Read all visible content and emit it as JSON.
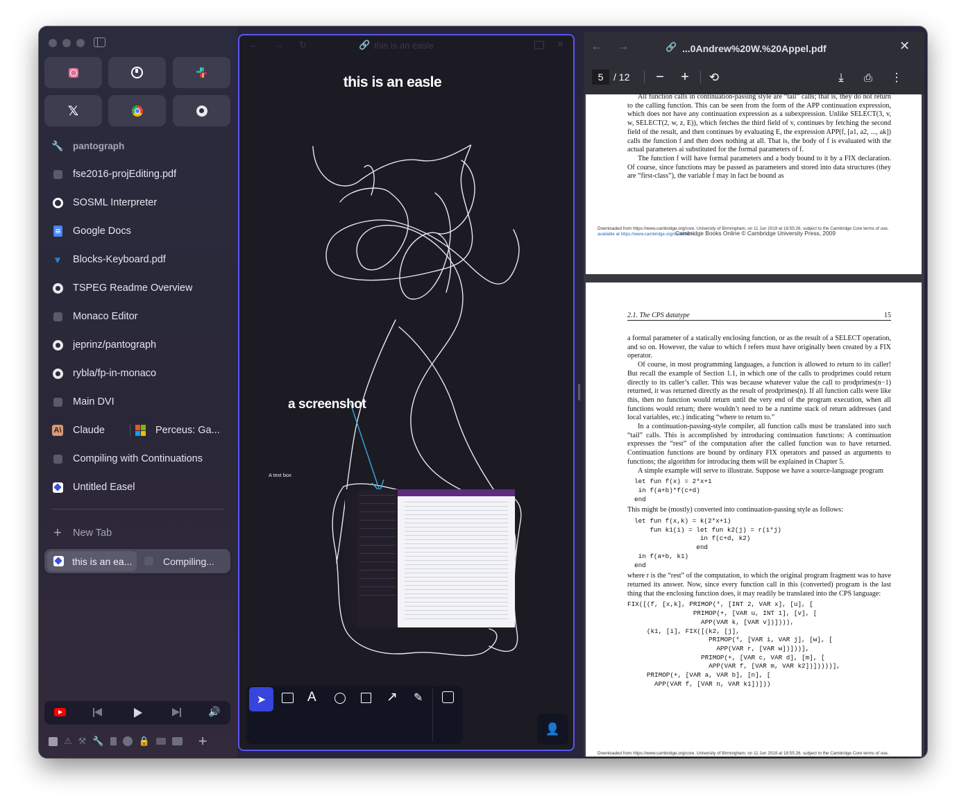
{
  "sidebar": {
    "pinned": [
      {
        "name": "app-pin-1",
        "icon": "alarm-icon"
      },
      {
        "name": "app-pin-2",
        "icon": "tracker-icon"
      },
      {
        "name": "app-pin-3",
        "icon": "slack-icon"
      },
      {
        "name": "app-pin-4",
        "icon": "x-icon"
      },
      {
        "name": "app-pin-5",
        "icon": "chrome-icon"
      },
      {
        "name": "app-pin-6",
        "icon": "github-icon"
      }
    ],
    "folder": "pantograph",
    "tabs": [
      {
        "label": "fse2016-projEditing.pdf",
        "icon": "blank-page-icon"
      },
      {
        "label": "SOSML Interpreter",
        "icon": "ring-icon"
      },
      {
        "label": "Google Docs",
        "icon": "google-docs-icon"
      },
      {
        "label": "Blocks-Keyboard.pdf",
        "icon": "vscode-icon"
      },
      {
        "label": "TSPEG Readme Overview",
        "icon": "github-icon"
      },
      {
        "label": "Monaco Editor",
        "icon": "blank-page-icon"
      },
      {
        "label": "jeprinz/pantograph",
        "icon": "github-icon"
      },
      {
        "label": "rybla/fp-in-monaco",
        "icon": "github-icon"
      },
      {
        "label": "Main DVI",
        "icon": "blank-page-icon"
      }
    ],
    "split_row": {
      "left": "Claude",
      "right": "Perceus: Ga..."
    },
    "tabs2": [
      {
        "label": "Compiling with Continuations",
        "icon": "blank-page-icon"
      },
      {
        "label": "Untitled Easel",
        "icon": "easel-icon"
      }
    ],
    "new_tab": "New Tab",
    "active_split": {
      "left": "this is an ea...",
      "right": "Compiling..."
    }
  },
  "easel": {
    "url": "this is an easle",
    "title_text": "this is an easle",
    "annotation": "a screenshot",
    "textbox": "A text box",
    "accent": "#5a56f0"
  },
  "pdf": {
    "url": "...0Andrew%20W.%20Appel.pdf",
    "page_current": "5",
    "page_total": "/ 12",
    "page_top": {
      "text": "All function calls in continuation-passing style are “tail” calls; that is, they do not return to the calling function. This can be seen from the form of the APP continuation expression, which does not have any continuation expression as a subexpression. Unlike SELECT(3, v, w, SELECT(2, w, z, E)), which fetches the third field of v, continues by fetching the second field of the result, and then continues by evaluating E, the expression APP(f, [a1, a2, ..., ak]) calls the function f and then does nothing at all. That is, the body of f is evaluated with the actual parameters ai substituted for the formal parameters of f.",
      "text2": "The function f will have formal parameters and a body bound to it by a FIX declaration. Of course, since functions may be passed as parameters and stored into data structures (they are “first-class”), the variable f may in fact be bound as",
      "footer1": "Downloaded from https://www.cambridge.org/core. University of Birmingham, on 11 Jun 2019 at 18:55:26, subject to the Cambridge Core terms of use,",
      "footer2": "available at https://www.cambridge.org/core/terms.",
      "footer3": "Cambridge Books Online © Cambridge University Press, 2009"
    },
    "page_bottom": {
      "header": "2.1.   The CPS datatype",
      "page_no": "15",
      "p1": "a formal parameter of a statically enclosing function, or as the result of a SELECT operation, and so on. However, the value to which f refers must have originally been created by a FIX operator.",
      "p2": "Of course, in most programming languages, a function is allowed to return to its caller! But recall the example of Section 1.1, in which one of the calls to prodprimes could return directly to its caller’s caller. This was because whatever value the call to prodprimes(n−1) returned, it was returned directly as the result of prodprimes(n). If all function calls were like this, then no function would return until the very end of the program execution, when all functions would return; there wouldn’t need to be a runtime stack of return addresses (and local variables, etc.) indicating “where to return to.”",
      "p3": "In a continuation-passing-style compiler, all function calls must be translated into such “tail” calls. This is accomplished by introducing continuation functions: A continuation expresses the “rest” of the computation after the called function was to have returned. Continuation functions are bound by ordinary FIX operators and passed as arguments to functions; the algorithm for introducing them will be explained in Chapter 5.",
      "p4": "A simple example will serve to illustrate. Suppose we have a source-language program",
      "code1": "let fun f(x) = 2*x+1\n in f(a+b)*f(c+d)\nend",
      "p5": "This might be (mostly) converted into continuation-passing style as follows:",
      "code2": "let fun f(x,k) = k(2*x+1)\n    fun k1(i) = let fun k2(j) = r(i*j)\n                 in f(c+d, k2)\n                end\n in f(a+b, k1)\nend",
      "p6": "where r is the “rest” of the computation, to which the original program fragment was to have returned its answer. Now, since every function call in this (converted) program is the last thing that the enclosing function does, it may readily be translated into the CPS language:",
      "code3": "FIX([(f, [x,k], PRIMOP(*, [INT 2, VAR x], [u], [\n                 PRIMOP(+, [VAR u, INT 1], [v], [\n                   APP(VAR k, [VAR v])]))),\n     (k1, [i], FIX([(k2, [j],\n                     PRIMOP(*, [VAR i, VAR j], [w], [\n                       APP(VAR r, [VAR w])]))],\n                   PRIMOP(+, [VAR c, VAR d], [m], [\n                     APP(VAR f, [VAR m, VAR k2])]))))],\n     PRIMOP(+, [VAR a, VAR b], [n], [\n       APP(VAR f, [VAR n, VAR k1])]))",
      "footer1": "Downloaded from https://www.cambridge.org/core. University of Birmingham, on 11 Jun 2019 at 18:55:26, subject to the Cambridge Core terms of use,"
    }
  }
}
